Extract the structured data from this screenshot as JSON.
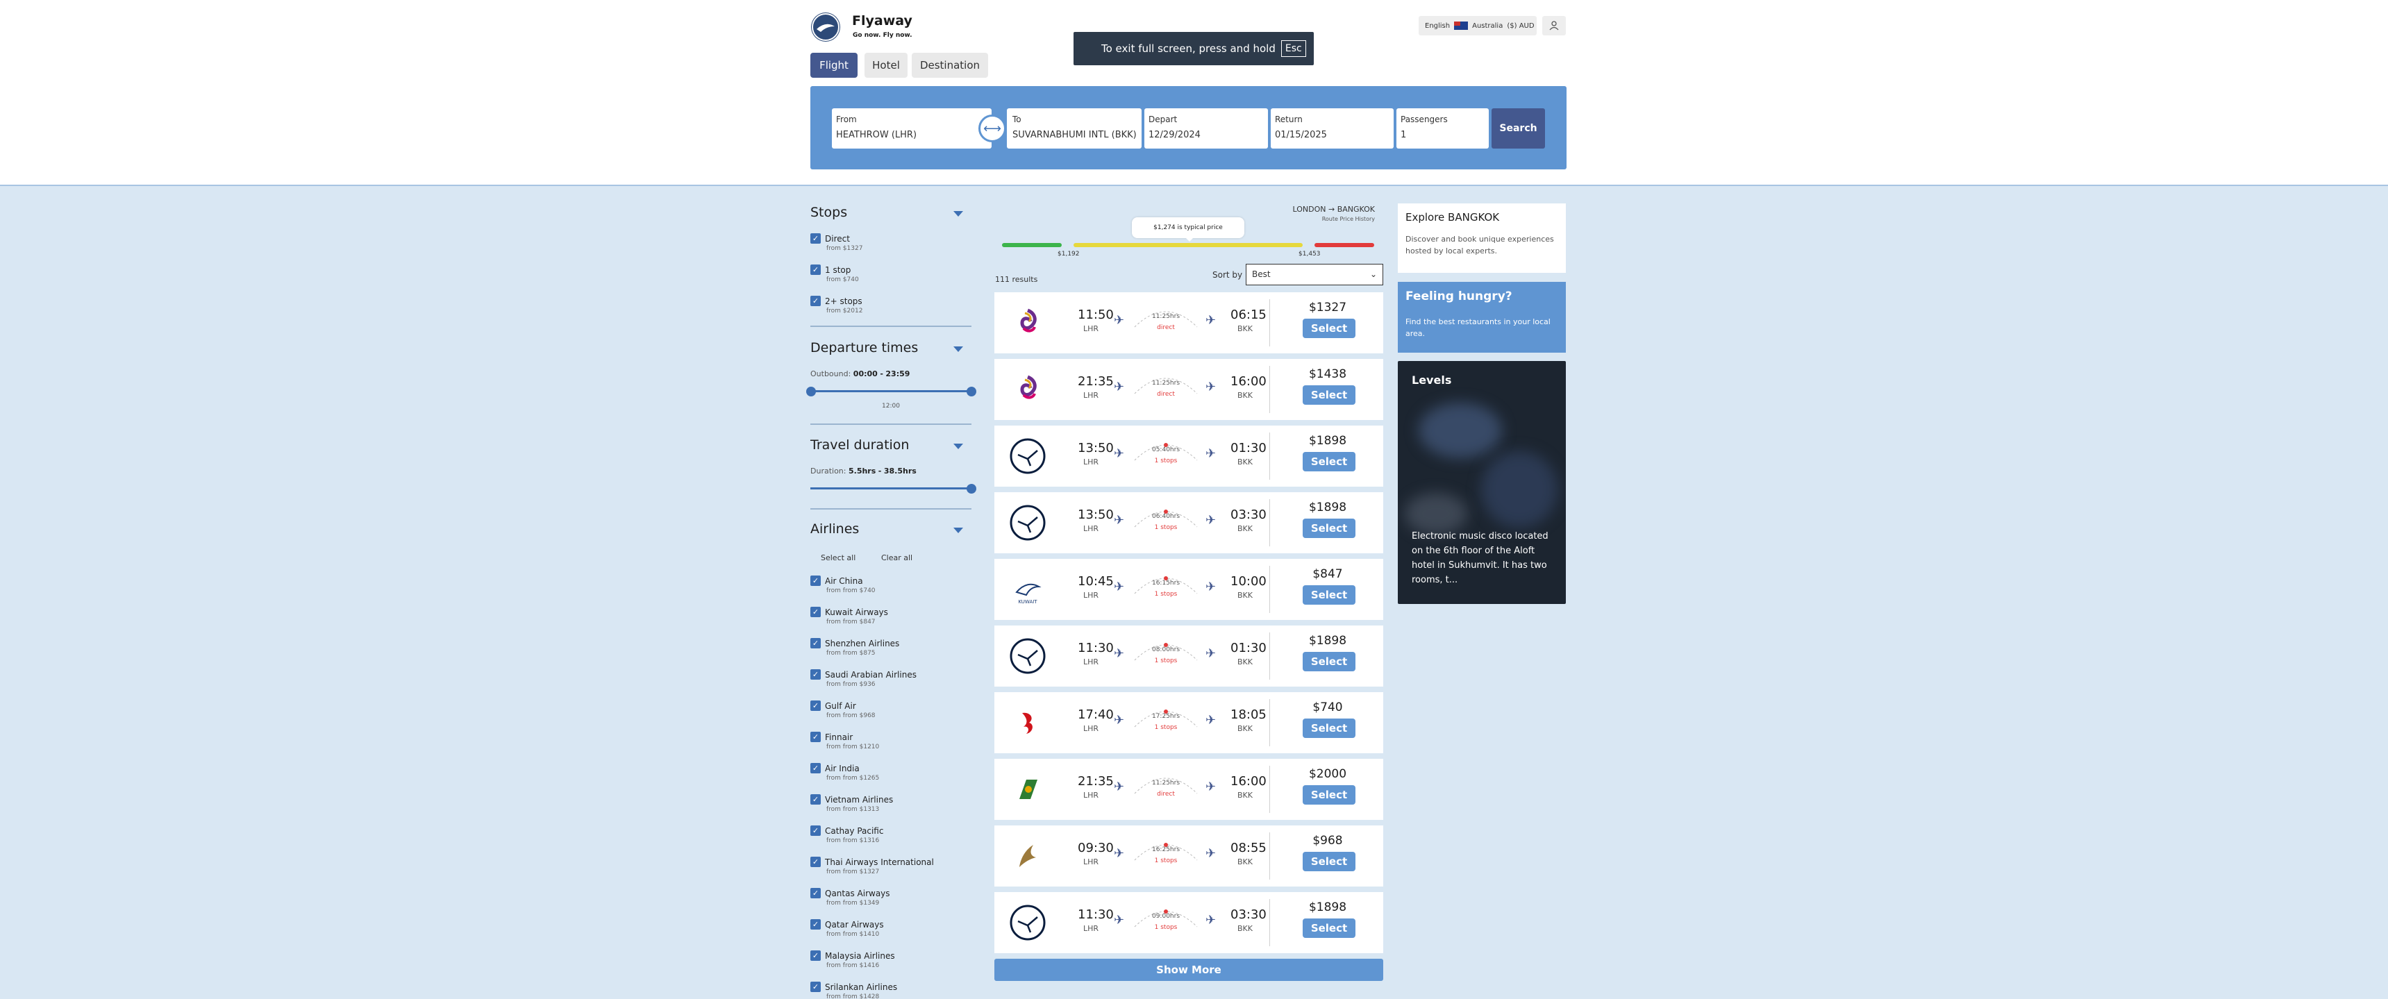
{
  "header": {
    "brand": "Flyaway",
    "tagline": "Go now. Fly now.",
    "tabs": [
      {
        "label": "Flight",
        "active": true
      },
      {
        "label": "Hotel",
        "active": false
      },
      {
        "label": "Destination",
        "active": false
      }
    ],
    "locale": {
      "language": "English",
      "country": "Australia",
      "currency": "($) AUD"
    },
    "fullscreen_toast": {
      "text": "To exit full screen, press and hold",
      "key": "Esc"
    }
  },
  "search": {
    "from": {
      "label": "From",
      "value": "HEATHROW (LHR)"
    },
    "to": {
      "label": "To",
      "value": "SUVARNABHUMI INTL (BKK)"
    },
    "depart": {
      "label": "Depart",
      "value": "12/29/2024"
    },
    "return": {
      "label": "Return",
      "value": "01/15/2025"
    },
    "passengers": {
      "label": "Passengers",
      "value": "1"
    },
    "button": "Search",
    "swap_icon": "swap-arrows-icon"
  },
  "filters": {
    "stops": {
      "title": "Stops",
      "options": [
        {
          "label": "Direct",
          "sub": "from $1327",
          "checked": true
        },
        {
          "label": "1 stop",
          "sub": "from $740",
          "checked": true
        },
        {
          "label": "2+ stops",
          "sub": "from $2012",
          "checked": true
        }
      ]
    },
    "departure": {
      "title": "Departure times",
      "label": "Outbound:",
      "from": "00:00",
      "sep": "-",
      "to": "23:59",
      "mid": "12:00"
    },
    "duration": {
      "title": "Travel duration",
      "label": "Duration:",
      "from": "5.5hrs",
      "sep": "-",
      "to": "38.5hrs"
    },
    "airlines": {
      "title": "Airlines",
      "select_all": "Select all",
      "clear_all": "Clear all",
      "items": [
        {
          "label": "Air China",
          "sub": "from from $740"
        },
        {
          "label": "Kuwait Airways",
          "sub": "from from $847"
        },
        {
          "label": "Shenzhen Airlines",
          "sub": "from from $875"
        },
        {
          "label": "Saudi Arabian Airlines",
          "sub": "from from $936"
        },
        {
          "label": "Gulf Air",
          "sub": "from from $968"
        },
        {
          "label": "Finnair",
          "sub": "from from $1210"
        },
        {
          "label": "Air India",
          "sub": "from from $1265"
        },
        {
          "label": "Vietnam Airlines",
          "sub": "from from $1313"
        },
        {
          "label": "Cathay Pacific",
          "sub": "from from $1316"
        },
        {
          "label": "Thai Airways International",
          "sub": "from from $1327"
        },
        {
          "label": "Qantas Airways",
          "sub": "from from $1349"
        },
        {
          "label": "Qatar Airways",
          "sub": "from from $1410"
        },
        {
          "label": "Malaysia Airlines",
          "sub": "from from $1416"
        },
        {
          "label": "Srilankan Airlines",
          "sub": "from from $1428"
        }
      ]
    }
  },
  "results": {
    "route": "LONDON → BANGKOK",
    "route_sub": "Route Price History",
    "typical": "$1,274 is typical price",
    "low_price": "$1,192",
    "high_price": "$1,453",
    "count": "111 results",
    "sort_label": "Sort by",
    "sort_value": "Best",
    "show_more": "Show More",
    "flights": [
      {
        "airline": "thai",
        "dep": "11:50",
        "from": "LHR",
        "arr": "06:15",
        "to": "BKK",
        "dur": "11:25hrs",
        "stops": "direct",
        "price": "$1327",
        "select": "Select"
      },
      {
        "airline": "thai",
        "dep": "21:35",
        "from": "LHR",
        "arr": "16:00",
        "to": "BKK",
        "dur": "11:25hrs",
        "stops": "direct",
        "price": "$1438",
        "select": "Select"
      },
      {
        "airline": "lufthansa",
        "dep": "13:50",
        "from": "LHR",
        "arr": "01:30",
        "to": "BKK",
        "dur": "05:40hrs",
        "stops": "1 stops",
        "price": "$1898",
        "select": "Select"
      },
      {
        "airline": "lufthansa",
        "dep": "13:50",
        "from": "LHR",
        "arr": "03:30",
        "to": "BKK",
        "dur": "06:40hrs",
        "stops": "1 stops",
        "price": "$1898",
        "select": "Select"
      },
      {
        "airline": "kuwait",
        "dep": "10:45",
        "from": "LHR",
        "arr": "10:00",
        "to": "BKK",
        "dur": "16:15hrs",
        "stops": "1 stops",
        "price": "$847",
        "select": "Select"
      },
      {
        "airline": "lufthansa",
        "dep": "11:30",
        "from": "LHR",
        "arr": "01:30",
        "to": "BKK",
        "dur": "08:00hrs",
        "stops": "1 stops",
        "price": "$1898",
        "select": "Select"
      },
      {
        "airline": "airchina",
        "dep": "17:40",
        "from": "LHR",
        "arr": "18:05",
        "to": "BKK",
        "dur": "17:25hrs",
        "stops": "1 stops",
        "price": "$740",
        "select": "Select"
      },
      {
        "airline": "eva",
        "dep": "21:35",
        "from": "LHR",
        "arr": "16:00",
        "to": "BKK",
        "dur": "11:25hrs",
        "stops": "direct",
        "price": "$2000",
        "select": "Select"
      },
      {
        "airline": "gulf",
        "dep": "09:30",
        "from": "LHR",
        "arr": "08:55",
        "to": "BKK",
        "dur": "16:25hrs",
        "stops": "1 stops",
        "price": "$968",
        "select": "Select"
      },
      {
        "airline": "lufthansa",
        "dep": "11:30",
        "from": "LHR",
        "arr": "03:30",
        "to": "BKK",
        "dur": "09:00hrs",
        "stops": "1 stops",
        "price": "$1898",
        "select": "Select"
      }
    ]
  },
  "sidebar": {
    "explore": {
      "title": "Explore BANGKOK",
      "text": "Discover and book unique experiences hosted by local experts."
    },
    "hungry": {
      "title": "Feeling hungry?",
      "text": "Find the best restaurants in your local area."
    },
    "levels": {
      "title": "Levels",
      "text": "Electronic music disco located on the 6th floor of the Aloft hotel in Sukhumvit. It has two rooms, t..."
    }
  },
  "colors": {
    "brand": "#44588f",
    "accent": "#5f95d2",
    "background": "#d9e7f3",
    "stops_red": "#e23b3b",
    "price_green": "#3cb44b",
    "price_yellow": "#e6d83c",
    "price_red": "#e23b3b"
  }
}
